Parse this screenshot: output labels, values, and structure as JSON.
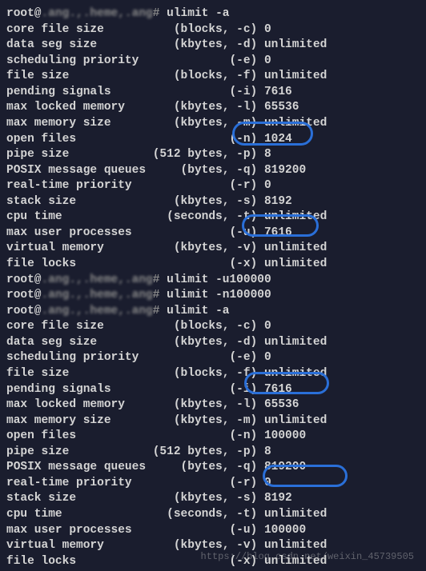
{
  "prompt": {
    "user": "root@",
    "host": ".ang.,.heme,.ang",
    "path": "#",
    "cmd1": "ulimit -a",
    "cmd2": "ulimit -u100000",
    "cmd3": "ulimit -n100000",
    "cmd4": "ulimit -a"
  },
  "before": {
    "l01": "core file size          (blocks, -c) 0",
    "l02": "data seg size           (kbytes, -d) unlimited",
    "l03": "scheduling priority             (-e) 0",
    "l04": "file size               (blocks, -f) unlimited",
    "l05": "pending signals                 (-i) 7616",
    "l06": "max locked memory       (kbytes, -l) 65536",
    "l07": "max memory size         (kbytes, -m) unlimited",
    "l08": "open files                      (-n) 1024",
    "l09": "pipe size            (512 bytes, -p) 8",
    "l10": "POSIX message queues     (bytes, -q) 819200",
    "l11": "real-time priority              (-r) 0",
    "l12": "stack size              (kbytes, -s) 8192",
    "l13": "cpu time               (seconds, -t) unlimited",
    "l14": "max user processes              (-u) 7616",
    "l15": "virtual memory          (kbytes, -v) unlimited",
    "l16": "file locks                      (-x) unlimited"
  },
  "after": {
    "l01": "core file size          (blocks, -c) 0",
    "l02": "data seg size           (kbytes, -d) unlimited",
    "l03": "scheduling priority             (-e) 0",
    "l04": "file size               (blocks, -f) unlimited",
    "l05": "pending signals                 (-i) 7616",
    "l06": "max locked memory       (kbytes, -l) 65536",
    "l07": "max memory size         (kbytes, -m) unlimited",
    "l08": "open files                      (-n) 100000",
    "l09": "pipe size            (512 bytes, -p) 8",
    "l10": "POSIX message queues     (bytes, -q) 819200",
    "l11": "real-time priority              (-r) 0",
    "l12": "stack size              (kbytes, -s) 8192",
    "l13": "cpu time               (seconds, -t) unlimited",
    "l14": "max user processes              (-u) 100000",
    "l15": "virtual memory          (kbytes, -v) unlimited",
    "l16": "file locks                      (-x) unlimited"
  },
  "watermark": "https://blog.csdn.net/weixin_45739505"
}
